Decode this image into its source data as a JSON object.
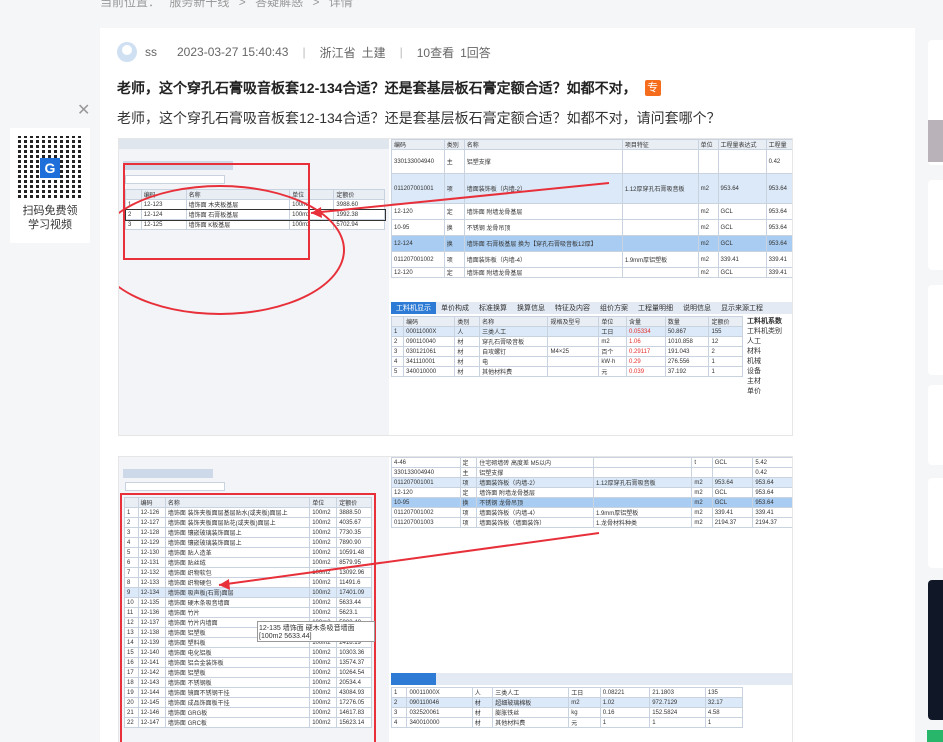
{
  "breadcrumb": {
    "label": "当前位置：",
    "items": [
      "服务新干线",
      ">",
      "答疑解惑",
      ">",
      "详情"
    ]
  },
  "question": {
    "user": "ss",
    "date": "2023-03-27 15:40:43",
    "region": "浙江省",
    "major": "土建",
    "views": "10查看",
    "answers": "1回答",
    "title": "老师，这个穿孔石膏吸音板套12-134合适？还是套基层板石膏定额合适？如都不对，",
    "tag": "专",
    "body": "老师，这个穿孔石膏吸音板套12-134合适？还是套基层板石膏定额合适？如都不对，请问套哪个？"
  },
  "qr": {
    "line1": "扫码免费领",
    "line2": "学习视频",
    "logo": "G"
  },
  "close_icon": "close-icon",
  "shot1": {
    "left_header": [
      "编码",
      "名称",
      "单位",
      "定额价"
    ],
    "left_rows": [
      [
        "1",
        "12-123",
        "墙饰面 木夹板基层",
        "100m2",
        "3988.60"
      ],
      [
        "2",
        "12-124",
        "墙饰面 石膏板基层",
        "100m2",
        "1992.38"
      ],
      [
        "3",
        "12-125",
        "墙饰面 K板基层",
        "100m2",
        "5702.94"
      ]
    ],
    "right_header": [
      "编码",
      "类别",
      "名称",
      "项目特征",
      "单位",
      "工程量表达式",
      "工程量"
    ],
    "right_rows": [
      [
        "330133004940",
        "主",
        "铝塑支撑",
        "",
        "",
        "",
        "0.42"
      ],
      [
        "011207001001",
        "项",
        "墙面装饰板（内墙-2）",
        "1.12厚穿孔石膏吸音板",
        "m2",
        "953.64",
        "953.64"
      ],
      [
        "12-120",
        "定",
        "墙饰面 附墙龙骨基层",
        "",
        "m2",
        "GCL",
        "953.64"
      ],
      [
        "10-95",
        "换",
        "不锈钢 龙骨吊顶",
        "",
        "m2",
        "GCL",
        "953.64"
      ],
      [
        "12-124",
        "换",
        "墙饰面 石膏板基层 换为【穿孔石膏吸音板12厚】",
        "",
        "m2",
        "GCL",
        "953.64"
      ],
      [
        "011207001002",
        "项",
        "墙面装饰板（内墙-4）",
        "1.9mm厚铝塑板",
        "m2",
        "339.41",
        "339.41"
      ],
      [
        "12-120",
        "定",
        "墙饰面 附墙龙骨基层",
        "",
        "m2",
        "GCL",
        "339.41"
      ]
    ],
    "tabs": [
      "工料机显示",
      "单价构成",
      "标准换算",
      "换算信息",
      "特征及内容",
      "组价方案",
      "工程量明细",
      "说明信息",
      "显示来源工程"
    ],
    "res_header": [
      "编码",
      "类别",
      "名称",
      "规格及型号",
      "单位",
      "损耗率",
      "含量",
      "数量",
      "定额价"
    ],
    "res_rows": [
      [
        "1",
        "00011000X",
        "人",
        "三类人工",
        "",
        "工日",
        "0.05334",
        "50.867",
        "155"
      ],
      [
        "2",
        "090110040",
        "材",
        "穿孔石膏吸音板",
        "",
        "m2",
        "1.06",
        "1010.858",
        "12"
      ],
      [
        "3",
        "030121061",
        "材",
        "自攻螺钉",
        "M4×25",
        "百个",
        "0.29117",
        "191.043",
        "2"
      ],
      [
        "4",
        "341110001",
        "材",
        "电",
        "",
        "kW·h",
        "0.29",
        "276.556",
        "1"
      ],
      [
        "5",
        "340010000",
        "材",
        "其他材料费",
        "",
        "元",
        "0.039",
        "37.192",
        "1"
      ]
    ],
    "side_title": "工料机系数",
    "side_items": [
      "工料机类别",
      "人工",
      "材料",
      "机械",
      "设备",
      "主材",
      "单价"
    ]
  },
  "shot2": {
    "left_header": [
      "编码",
      "名称",
      "单位",
      "定额价"
    ],
    "left_rows": [
      [
        "1",
        "12-126",
        "墙饰面 装饰夹板面层基层贴水(或夹板)面层上",
        "100m2",
        "3888.50"
      ],
      [
        "2",
        "12-127",
        "墙饰面 装饰夹板面层贴花(或夹板)面层上",
        "100m2",
        "4035.67"
      ],
      [
        "3",
        "12-128",
        "墙饰面 镶嵌玻璃装饰面层上",
        "100m2",
        "7730.35"
      ],
      [
        "4",
        "12-129",
        "墙饰面 镶嵌玻璃装饰面层上",
        "100m2",
        "7890.90"
      ],
      [
        "5",
        "12-130",
        "墙饰面 贴人造革",
        "100m2",
        "10591.48"
      ],
      [
        "6",
        "12-131",
        "墙饰面 贴丝绒",
        "100m2",
        "8579.95"
      ],
      [
        "7",
        "12-132",
        "墙饰面 织物软包",
        "100m2",
        "13092.96"
      ],
      [
        "8",
        "12-133",
        "墙饰面 织物硬包",
        "100m2",
        "11491.6"
      ],
      [
        "9",
        "12-134",
        "墙饰面 吸声板(石膏)面层",
        "100m2",
        "17401.09"
      ],
      [
        "10",
        "12-135",
        "墙饰面 硬木条吸音墙面",
        "100m2",
        "5633.44"
      ],
      [
        "11",
        "12-136",
        "墙饰面 竹片",
        "100m2",
        "5623.1"
      ],
      [
        "12",
        "12-137",
        "墙饰面 竹片内墙面",
        "100m2",
        "5903.48"
      ],
      [
        "13",
        "12-138",
        "墙饰面 铝塑板",
        "100m2",
        "10254.94"
      ],
      [
        "14",
        "12-139",
        "墙饰面 塑料板",
        "100m2",
        "2418.19"
      ],
      [
        "15",
        "12-140",
        "墙饰面 电化铝板",
        "100m2",
        "10303.36"
      ],
      [
        "16",
        "12-141",
        "墙饰面 铝合金装饰板",
        "100m2",
        "13574.37"
      ],
      [
        "17",
        "12-142",
        "墙饰面 铝塑板",
        "100m2",
        "10264.54"
      ],
      [
        "18",
        "12-143",
        "墙饰面 不锈钢板",
        "100m2",
        "20534.4"
      ],
      [
        "19",
        "12-144",
        "墙饰面 镜面不锈钢干挂",
        "100m2",
        "43084.93"
      ],
      [
        "20",
        "12-145",
        "墙饰面 成品饰面板干挂",
        "100m2",
        "17276.05"
      ],
      [
        "21",
        "12-146",
        "墙饰面 GRG板",
        "100m2",
        "14617.83"
      ],
      [
        "22",
        "12-147",
        "墙饰面 GRC板",
        "100m2",
        "15623.14"
      ]
    ],
    "tooltip": "12-135 墙饰面 硬木条吸音墙面 [100m2 5633.44]",
    "right_rows": [
      [
        "4-46",
        "定",
        "住宅砌墙砖 高度差 M5以内",
        "",
        "t",
        "GCL",
        "5.42"
      ],
      [
        "330133004940",
        "主",
        "铝塑支撑",
        "",
        "",
        "",
        "0.42"
      ],
      [
        "011207001001",
        "项",
        "墙面装饰板（内墙-2）",
        "1.12厚穿孔石膏吸音板",
        "m2",
        "953.64",
        "953.64"
      ],
      [
        "12-120",
        "定",
        "墙饰面 附墙龙骨基层",
        "",
        "m2",
        "GCL",
        "953.64"
      ],
      [
        "10-95",
        "换",
        "不锈钢 龙骨吊顶",
        "",
        "m2",
        "GCL",
        "953.64"
      ],
      [
        "011207001002",
        "项",
        "墙面装饰板（内墙-4）",
        "1.9mm厚铝塑板",
        "m2",
        "339.41",
        "339.41"
      ],
      [
        "011207001003",
        "项",
        "墙面装饰板（墙面装饰）",
        "1.龙骨材料种类",
        "m2",
        "2194.37",
        "2194.37"
      ]
    ],
    "res_rows": [
      [
        "1",
        "00011000X",
        "人",
        "三类人工",
        "工日",
        "0.08221",
        "21.1803",
        "135"
      ],
      [
        "2",
        "090110046",
        "材",
        "超细玻璃棉板",
        "m2",
        "1.02",
        "972.7129",
        "32.17"
      ],
      [
        "3",
        "032520061",
        "材",
        "膨胀铁丝",
        "kg",
        "0.16",
        "152.5824",
        "4.58"
      ],
      [
        "4",
        "340010000",
        "材",
        "其他材料费",
        "元",
        "1",
        "1",
        "1"
      ]
    ]
  }
}
